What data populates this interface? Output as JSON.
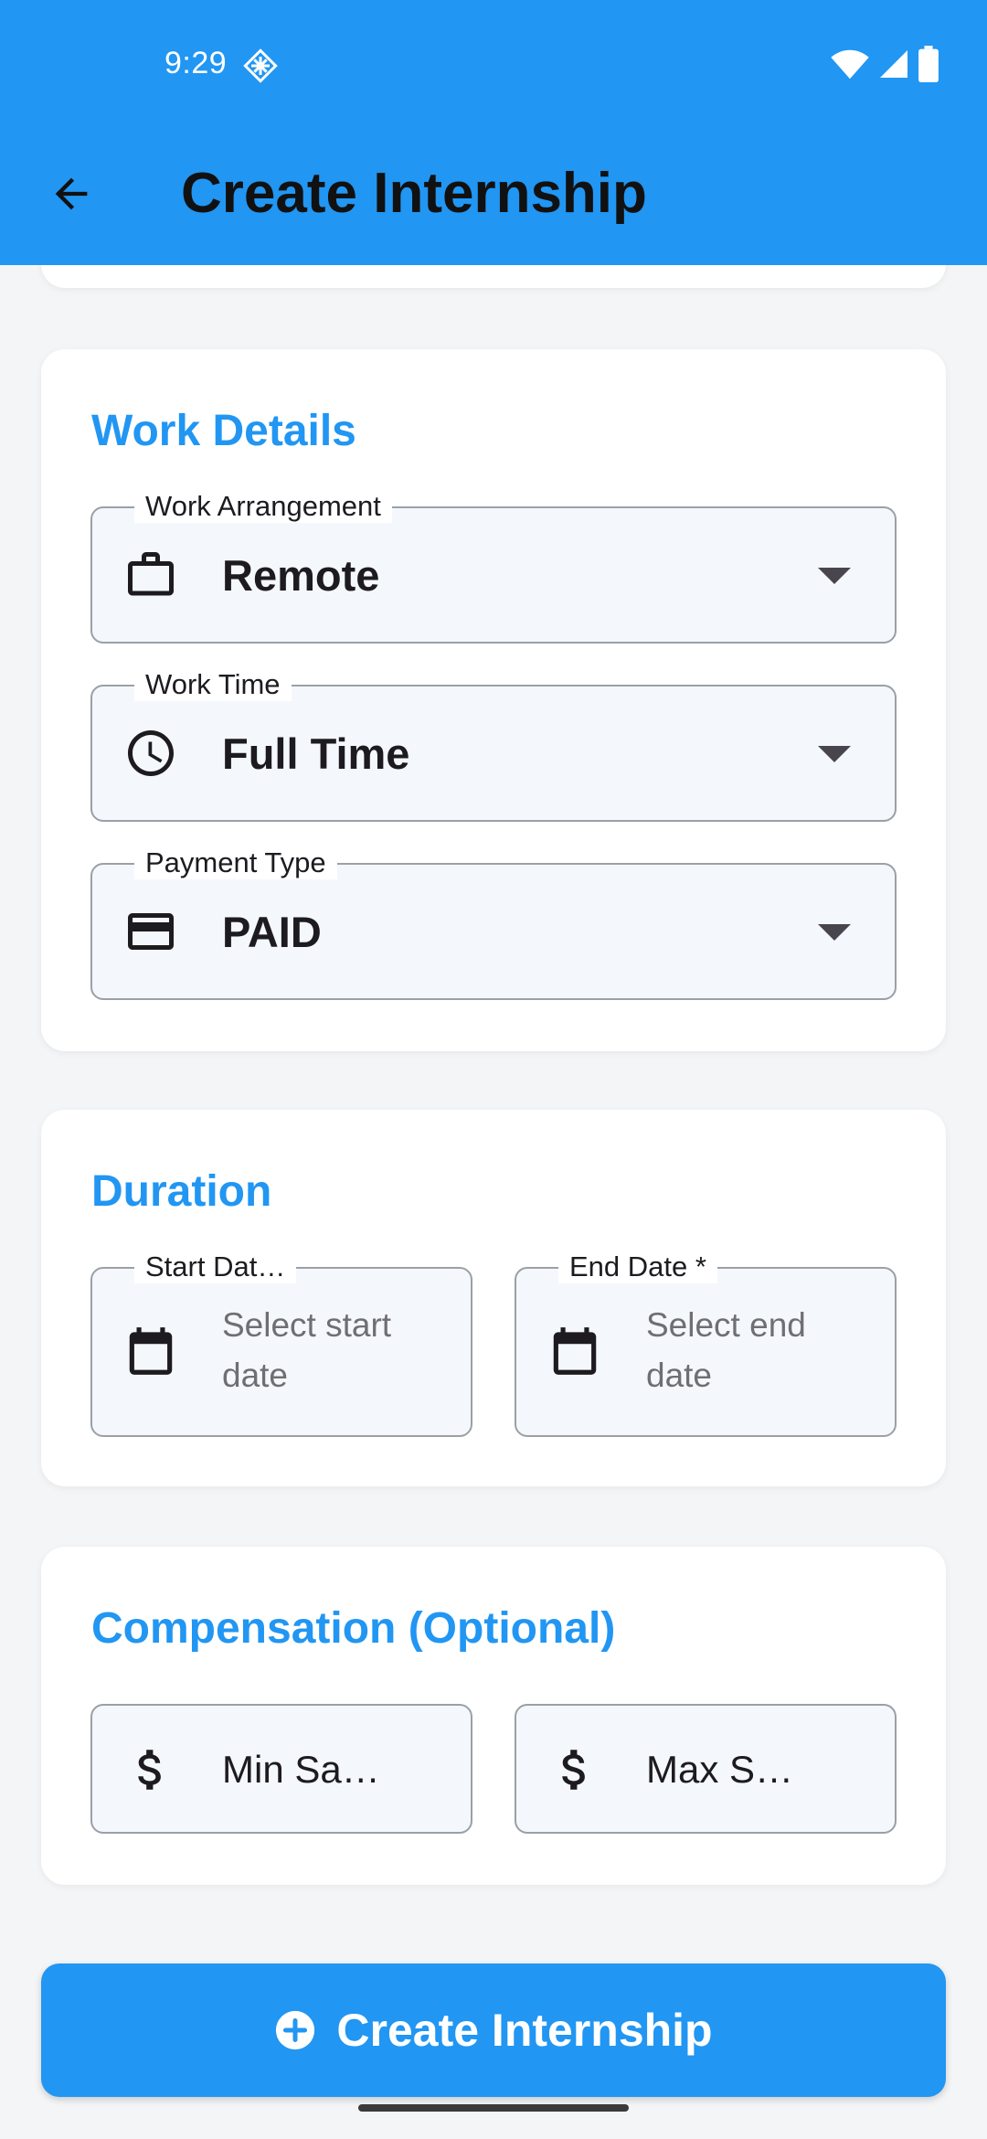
{
  "status_bar": {
    "time": "9:29"
  },
  "app_bar": {
    "title": "Create Internship",
    "back_icon": "arrow-back-icon"
  },
  "work_details": {
    "title": "Work Details",
    "work_arrangement": {
      "label": "Work Arrangement",
      "value": "Remote",
      "icon": "briefcase-icon"
    },
    "work_time": {
      "label": "Work Time",
      "value": "Full Time",
      "icon": "clock-icon"
    },
    "payment_type": {
      "label": "Payment Type",
      "value": "PAID",
      "icon": "credit-card-icon"
    }
  },
  "duration": {
    "title": "Duration",
    "start_date": {
      "label": "Start Dat…",
      "placeholder_line1": "Select start",
      "placeholder_line2": "date",
      "icon": "calendar-icon"
    },
    "end_date": {
      "label": "End Date *",
      "placeholder_line1": "Select end",
      "placeholder_line2": "date",
      "icon": "calendar-icon"
    }
  },
  "compensation": {
    "title": "Compensation (Optional)",
    "min_salary": {
      "placeholder": "Min Sa…",
      "icon": "dollar-icon"
    },
    "max_salary": {
      "placeholder": "Max S…",
      "icon": "dollar-icon"
    }
  },
  "submit_button": {
    "label": "Create Internship",
    "icon": "add-circle-icon"
  },
  "colors": {
    "primary": "#2196f3",
    "field_background": "#f4f8fd",
    "field_border": "#9aa0a6",
    "page_background": "#f4f5f7"
  }
}
